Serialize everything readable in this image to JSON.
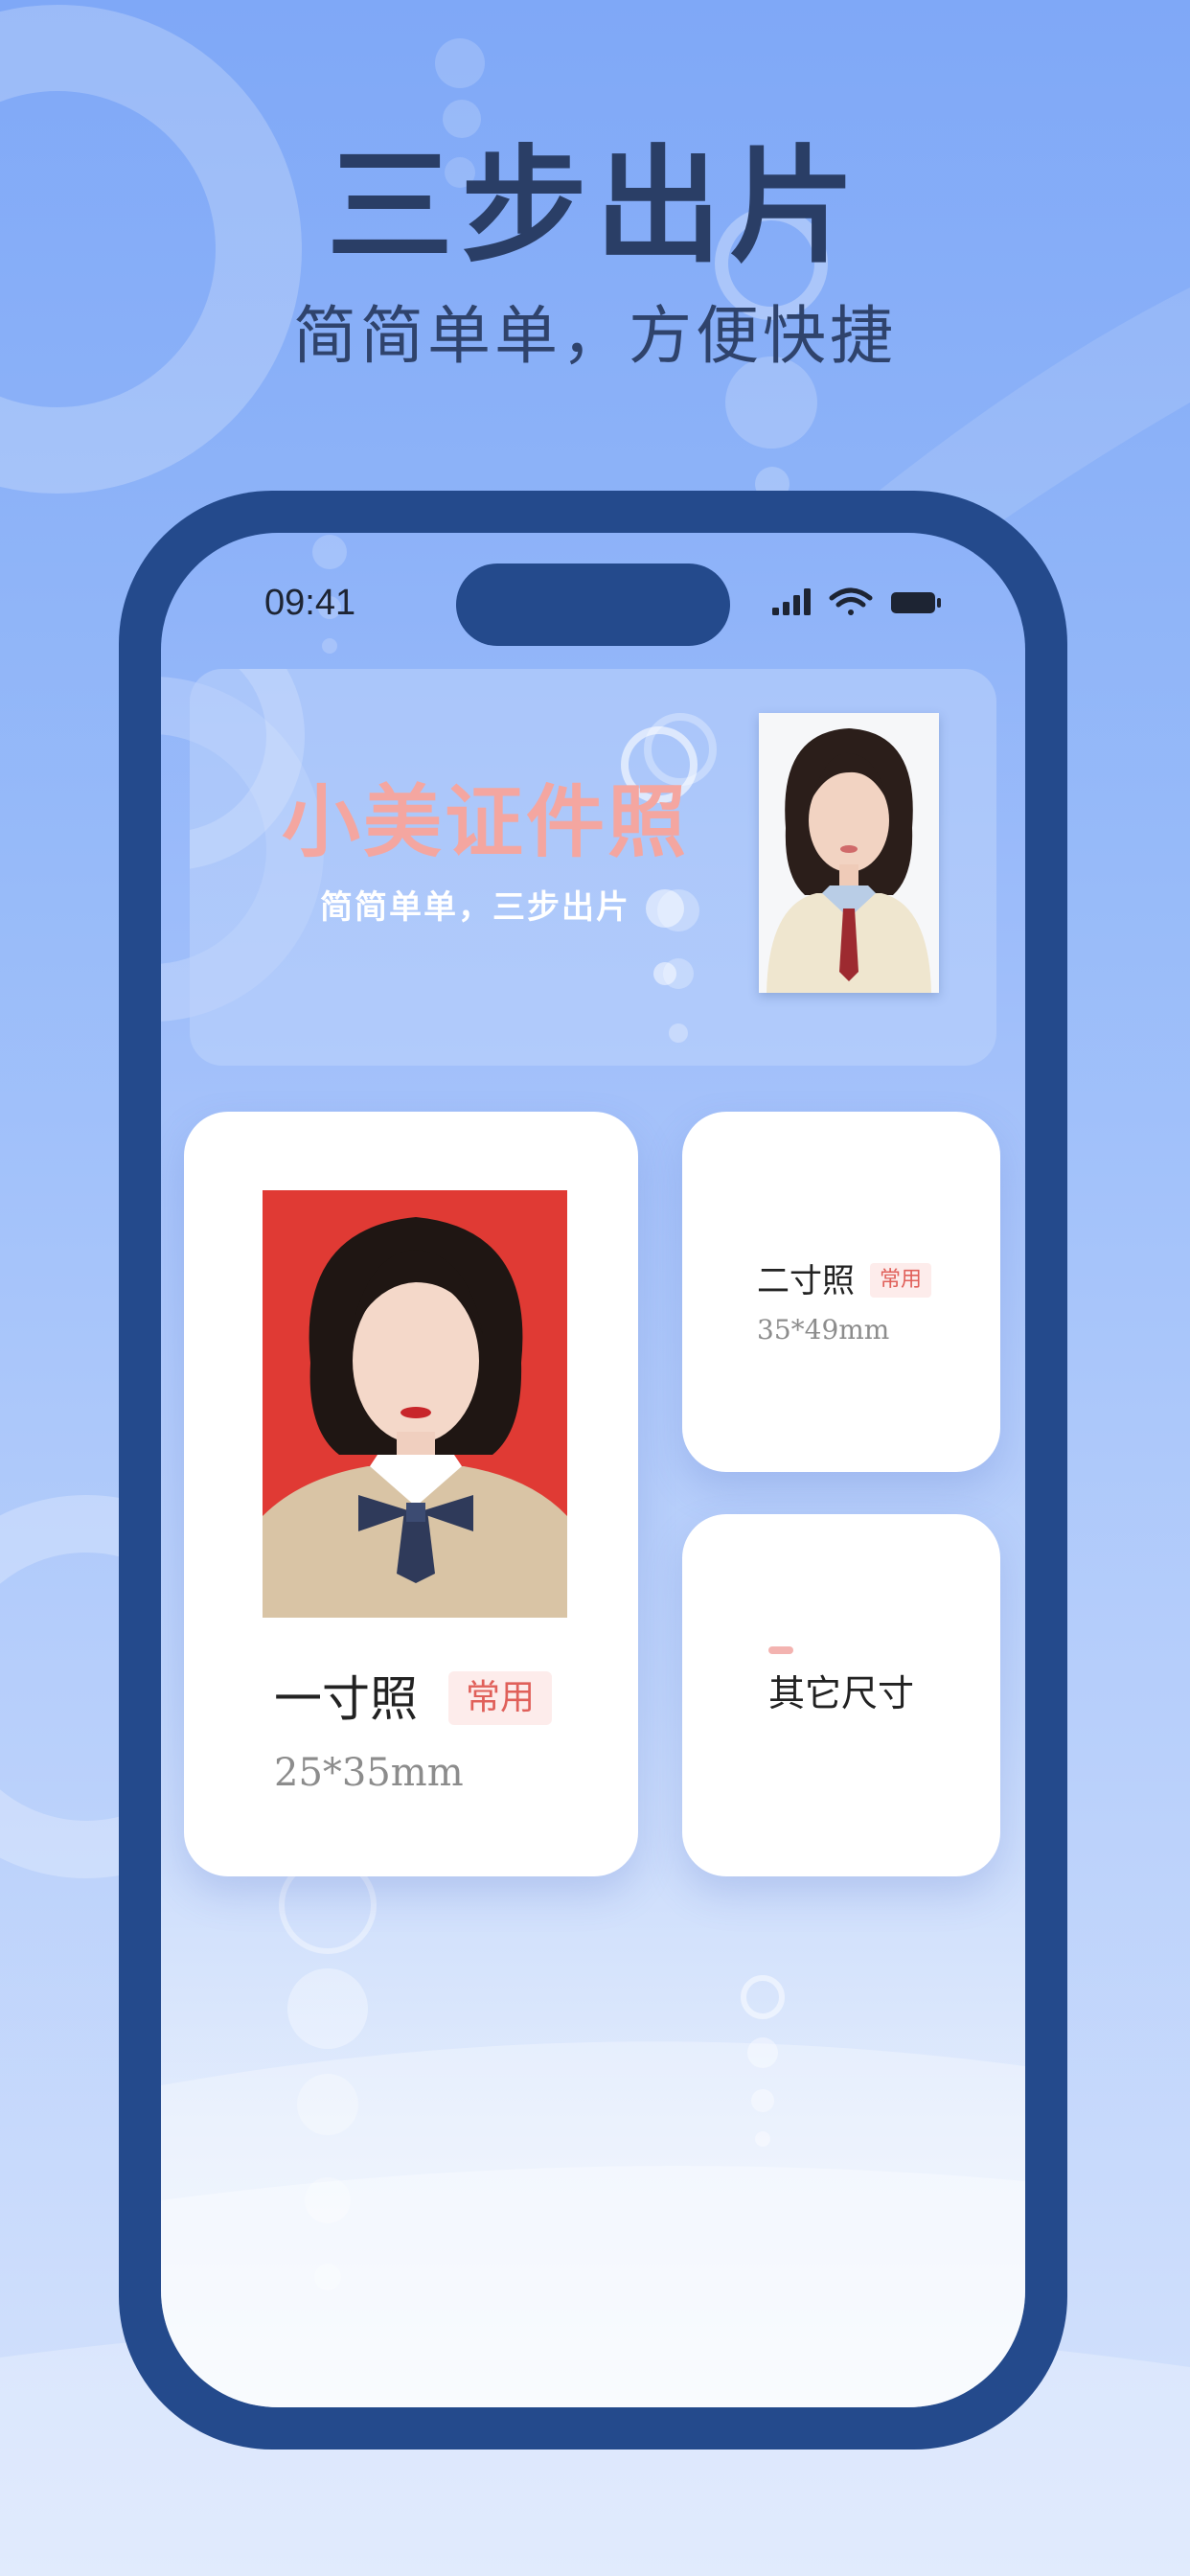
{
  "hero": {
    "title": "三步出片",
    "subtitle": "简简单单，方便快捷"
  },
  "status_bar": {
    "time": "09:41",
    "icons": [
      "signal-icon",
      "wifi-icon",
      "battery-icon"
    ]
  },
  "banner": {
    "title": "小美证件照",
    "subtitle": "简简单单，三步出片"
  },
  "cards": {
    "main": {
      "title": "一寸照",
      "tag": "常用",
      "size": "25*35mm",
      "photo_bg": "#e03a34"
    },
    "second": {
      "title": "二寸照",
      "tag": "常用",
      "size": "35*49mm"
    },
    "other": {
      "title": "其它尺寸"
    }
  },
  "colors": {
    "phone_frame": "#244a8c",
    "banner_title": "#f4a6a0",
    "tag_text": "#e0605a",
    "tag_bg": "#fdeceb",
    "headline": "#2a3e66"
  }
}
